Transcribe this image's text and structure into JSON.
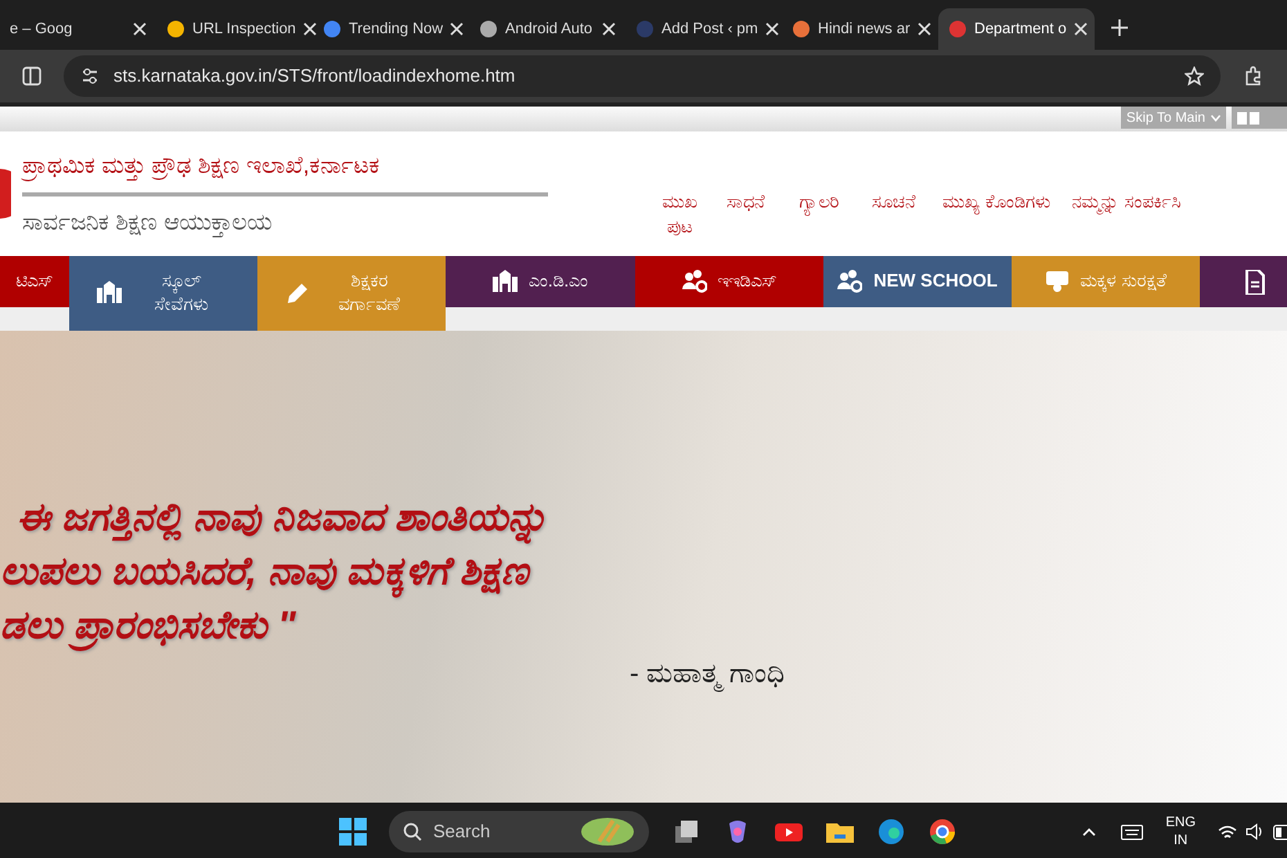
{
  "browser": {
    "tabs": [
      {
        "title": "e – Goog",
        "selected": false
      },
      {
        "title": "URL Inspection",
        "selected": false
      },
      {
        "title": "Trending Now",
        "selected": false
      },
      {
        "title": "Android Auto",
        "selected": false
      },
      {
        "title": "Add Post ‹ pm",
        "selected": false
      },
      {
        "title": "Hindi news ar",
        "selected": false
      },
      {
        "title": "Department o",
        "selected": true
      }
    ],
    "address": "sts.karnataka.gov.in/STS/front/loadindexhome.htm"
  },
  "utility_bar": {
    "skip_select": "Skip To Main"
  },
  "header": {
    "title": "ಪ್ರಾಥಮಿಕ ಮತ್ತು ಪ್ರೌಢ ಶಿಕ್ಷಣ ಇಲಾಖೆ,ಕರ್ನಾಟಕ",
    "subtitle": "ಸಾರ್ವಜನಿಕ ಶಿಕ್ಷಣ ಆಯುಕ್ತಾಲಯ",
    "menu": [
      "ಮುಖ ಪುಟ",
      "ಸಾಧನೆ",
      "ಗ್ಯಾಲರಿ",
      "ಸೂಚನೆ",
      "ಮುಖ್ಯ ಕೊಂಡಿಗಳು",
      "ನಮ್ಮನ್ನು ಸಂಪರ್ಕಿಸಿ"
    ]
  },
  "nav": [
    {
      "label": "ಟಿಎಸ್",
      "kind": "plain",
      "color": "#b00000"
    },
    {
      "label": "ಸ್ಕೂಲ್ ಸೇವೆಗಳು",
      "kind": "school",
      "color": "#3e5c84"
    },
    {
      "label": "ಶಿಕ್ಷಕರ ವರ್ಗಾವಣೆ",
      "kind": "pencil",
      "color": "#cf8f25"
    },
    {
      "label": "ಎಂ.ಡಿ.ಎಂ",
      "kind": "school",
      "color": "#522050"
    },
    {
      "label": "ಇಇಡಿಎಸ್",
      "kind": "people",
      "color": "#b00000"
    },
    {
      "label": "NEW SCHOOL",
      "kind": "people",
      "color": "#3e5c84"
    },
    {
      "label": "ಮಕ್ಕಳ ಸುರಕ್ಷತೆ",
      "kind": "child",
      "color": "#cf8f25"
    },
    {
      "kind": "document",
      "color": "#522050"
    }
  ],
  "hero": {
    "quote_lines": [
      "ಈ ಜಗತ್ತಿನಲ್ಲಿ ನಾವು ನಿಜವಾದ ಶಾಂತಿಯನ್ನು",
      "ಲುಪಲು ಬಯಸಿದರೆ, ನಾವು ಮಕ್ಕಳಿಗೆ ಶಿಕ್ಷಣ",
      "ಡಲು ಪ್ರಾರಂಭಿಸಬೇಕು \""
    ],
    "author": "- ಮಹಾತ್ಮ ಗಾಂಧಿ"
  },
  "taskbar": {
    "search": "Search",
    "language": "ENG",
    "region": "IN"
  }
}
